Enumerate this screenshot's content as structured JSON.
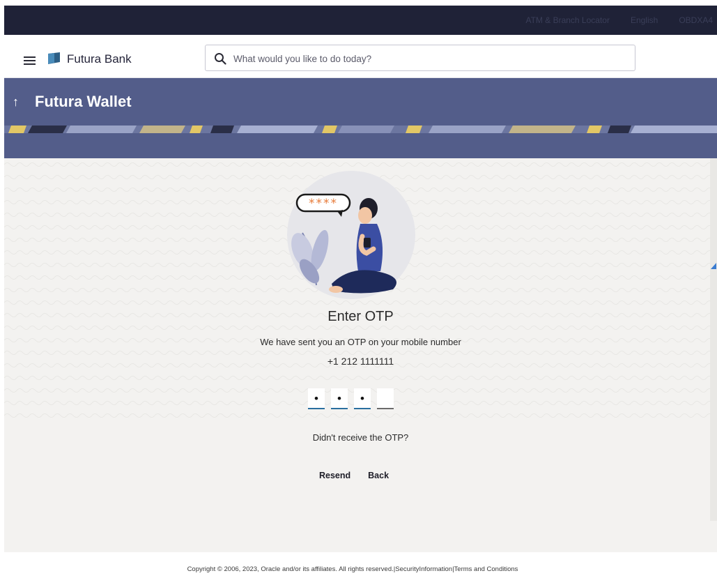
{
  "topbar": {
    "links": [
      "ATM & Branch Locator",
      "English",
      "OBDXA4"
    ]
  },
  "header": {
    "brand": "Futura Bank",
    "search_placeholder": "What would you like to do today?"
  },
  "banner": {
    "title": "Futura Wallet"
  },
  "otp": {
    "title": "Enter OTP",
    "message": "We have sent you an OTP on your mobile number",
    "mobile": "+1 212 1111111",
    "bubble_text": "****",
    "digits": [
      "•",
      "•",
      "•",
      ""
    ]
  },
  "prompt": "Didn't receive the OTP?",
  "actions": {
    "resend": "Resend",
    "back": "Back"
  },
  "footer": {
    "copyright": "Copyright © 2006, 2023, Oracle and/or its affiliates. All rights reserved.|",
    "security": "SecurityInformation",
    "sep": "|",
    "terms": "Terms and Conditions"
  },
  "colors": {
    "topbar": "#1f2237",
    "banner": "#535d8a",
    "accent": "#2a6f9f",
    "illustration_primary": "#3b4ea3",
    "bubble_stars": "#e77b3a"
  },
  "icons": {
    "menu": "hamburger-icon",
    "logo": "bank-logo-icon",
    "search": "search-icon",
    "back": "up-arrow-icon"
  }
}
